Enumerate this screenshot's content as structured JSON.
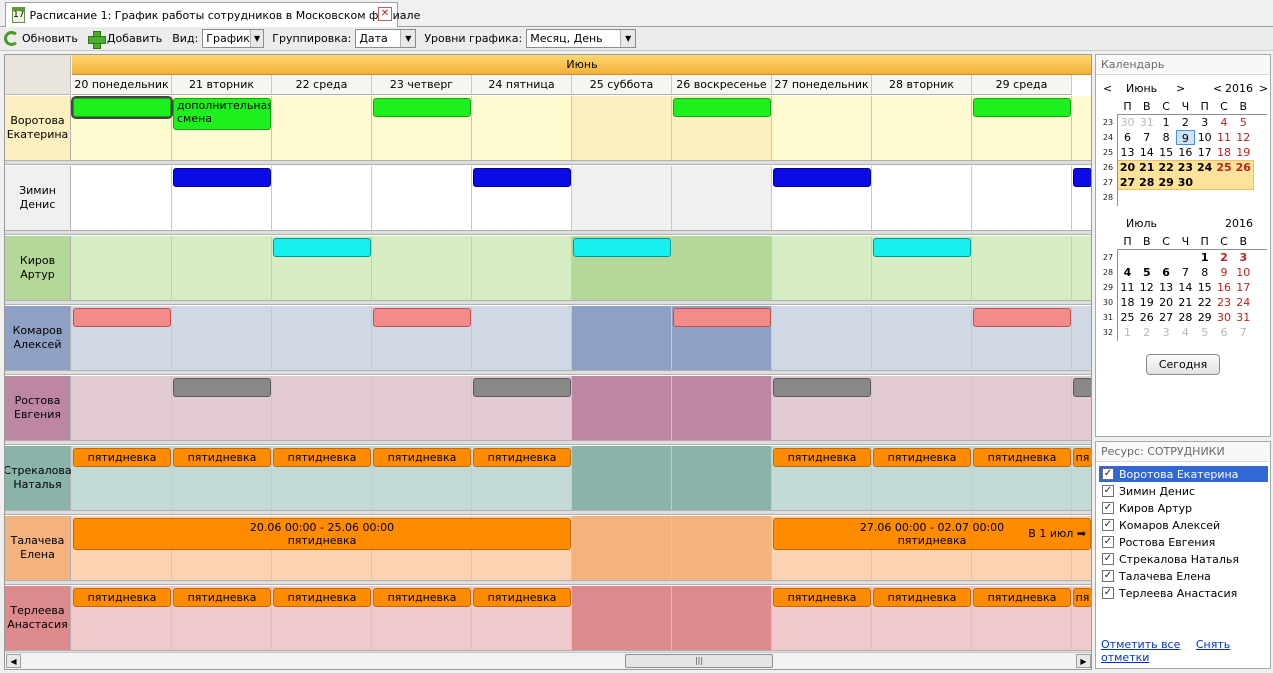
{
  "tab": {
    "icon": "calendar-icon",
    "icon_text": "17",
    "title": "Расписание 1: График работы сотрудников в Московском филиале",
    "close": "✕"
  },
  "toolbar": {
    "refresh": "Обновить",
    "add": "Добавить",
    "view_label": "Вид:",
    "view_value": "График",
    "group_label": "Группировка:",
    "group_value": "Дата",
    "levels_label": "Уровни графика:",
    "levels_value": "Месяц, День"
  },
  "schedule": {
    "month": "Июнь",
    "days": [
      "20 понедельник",
      "21 вторник",
      "22 среда",
      "23 четверг",
      "24 пятница",
      "25 суббота",
      "26 воскресенье",
      "27 понедельник",
      "28 вторник",
      "29 среда"
    ],
    "rows": [
      {
        "name": "Воротова Екатерина",
        "color": "#fffbd0",
        "weekend": "#fdf0c0",
        "events": [
          {
            "day": 0,
            "span": 1,
            "style": "green",
            "text": "",
            "selected": true
          },
          {
            "day": 1,
            "span": 1,
            "style": "green",
            "text": "дополнительная смена"
          },
          {
            "day": 3,
            "span": 1,
            "style": "green",
            "text": ""
          },
          {
            "day": 6,
            "span": 1,
            "style": "green",
            "text": ""
          },
          {
            "day": 9,
            "span": 1,
            "style": "green",
            "text": ""
          }
        ]
      },
      {
        "name": "Зимин Денис",
        "color": "#ffffff",
        "weekend": "#f0f0f0",
        "events": [
          {
            "day": 1,
            "span": 1,
            "style": "blue",
            "text": ""
          },
          {
            "day": 4,
            "span": 1,
            "style": "blue",
            "text": ""
          },
          {
            "day": 7,
            "span": 1,
            "style": "blue",
            "text": ""
          },
          {
            "day": 10,
            "span": 1,
            "style": "blue",
            "text": ""
          }
        ]
      },
      {
        "name": "Киров Артур",
        "color": "#d6ecc3",
        "weekend": "#b4d89a",
        "events": [
          {
            "day": 2,
            "span": 1,
            "style": "cyan",
            "text": ""
          },
          {
            "day": 5,
            "span": 1,
            "style": "cyan",
            "text": ""
          },
          {
            "day": 8,
            "span": 1,
            "style": "cyan",
            "text": ""
          }
        ]
      },
      {
        "name": "Комаров Алексей",
        "color": "#d0d8e6",
        "weekend": "#8ea0c3",
        "events": [
          {
            "day": 0,
            "span": 1,
            "style": "pink",
            "text": ""
          },
          {
            "day": 3,
            "span": 1,
            "style": "pink",
            "text": ""
          },
          {
            "day": 6,
            "span": 1,
            "style": "pink",
            "text": ""
          },
          {
            "day": 9,
            "span": 1,
            "style": "pink",
            "text": ""
          }
        ]
      },
      {
        "name": "Ростова Евгения",
        "color": "#e3cbd6",
        "weekend": "#bd87a3",
        "events": [
          {
            "day": 1,
            "span": 1,
            "style": "gray",
            "text": ""
          },
          {
            "day": 4,
            "span": 1,
            "style": "gray",
            "text": ""
          },
          {
            "day": 7,
            "span": 1,
            "style": "gray",
            "text": ""
          },
          {
            "day": 10,
            "span": 1,
            "style": "gray",
            "text": ""
          }
        ]
      },
      {
        "name": "Стрекалова Наталья",
        "color": "#c3dad6",
        "weekend": "#8ab4aa",
        "events": [
          {
            "day": 0,
            "span": 1,
            "style": "orange",
            "text": "пятидневка"
          },
          {
            "day": 1,
            "span": 1,
            "style": "orange",
            "text": "пятидневка"
          },
          {
            "day": 2,
            "span": 1,
            "style": "orange",
            "text": "пятидневка"
          },
          {
            "day": 3,
            "span": 1,
            "style": "orange",
            "text": "пятидневка"
          },
          {
            "day": 4,
            "span": 1,
            "style": "orange",
            "text": "пятидневка"
          },
          {
            "day": 7,
            "span": 1,
            "style": "orange",
            "text": "пятидневка"
          },
          {
            "day": 8,
            "span": 1,
            "style": "orange",
            "text": "пятидневка"
          },
          {
            "day": 9,
            "span": 1,
            "style": "orange",
            "text": "пятидневка"
          },
          {
            "day": 10,
            "span": 1,
            "style": "orange",
            "text": "пя"
          }
        ]
      },
      {
        "name": "Талачева Елена",
        "color": "#fbd3b3",
        "weekend": "#f4b27e",
        "events": [
          {
            "day": 0,
            "span": 5,
            "style": "orange",
            "wide": true,
            "line1": "20.06 00:00 - 25.06 00:00",
            "line2": "пятидневка"
          },
          {
            "day": 7,
            "span": 3.2,
            "style": "orange",
            "wide": true,
            "line1": "27.06 00:00 - 02.07 00:00",
            "line2": "пятидневка",
            "more": "В 1 июл ➡"
          }
        ]
      },
      {
        "name": "Терлеева Анастасия",
        "color": "#f0c9cc",
        "weekend": "#dc8a8c",
        "events": [
          {
            "day": 0,
            "span": 1,
            "style": "orange",
            "text": "пятидневка"
          },
          {
            "day": 1,
            "span": 1,
            "style": "orange",
            "text": "пятидневка"
          },
          {
            "day": 2,
            "span": 1,
            "style": "orange",
            "text": "пятидневка"
          },
          {
            "day": 3,
            "span": 1,
            "style": "orange",
            "text": "пятидневка"
          },
          {
            "day": 4,
            "span": 1,
            "style": "orange",
            "text": "пятидневка"
          },
          {
            "day": 7,
            "span": 1,
            "style": "orange",
            "text": "пятидневка"
          },
          {
            "day": 8,
            "span": 1,
            "style": "orange",
            "text": "пятидневка"
          },
          {
            "day": 9,
            "span": 1,
            "style": "orange",
            "text": "пятидневка"
          },
          {
            "day": 10,
            "span": 1,
            "style": "orange",
            "text": "пя"
          }
        ]
      }
    ],
    "scroll_thumb": "|||"
  },
  "calendar": {
    "title": "Календарь",
    "weekdays": [
      "П",
      "В",
      "С",
      "Ч",
      "П",
      "С",
      "В"
    ],
    "june": {
      "month": "Июнь",
      "year": "2016",
      "weeks": [
        "23",
        "24",
        "25",
        "26",
        "27",
        "28"
      ],
      "days": [
        [
          "30",
          "31",
          "1",
          "2",
          "3",
          "4",
          "5"
        ],
        [
          "6",
          "7",
          "8",
          "9",
          "10",
          "11",
          "12"
        ],
        [
          "13",
          "14",
          "15",
          "16",
          "17",
          "18",
          "19"
        ],
        [
          "20",
          "21",
          "22",
          "23",
          "24",
          "25",
          "26"
        ],
        [
          "27",
          "28",
          "29",
          "30",
          "",
          "",
          ""
        ],
        [
          "",
          "",
          "",
          "",
          "",
          "",
          ""
        ]
      ]
    },
    "july": {
      "month": "Июль",
      "year": "2016",
      "weeks": [
        "27",
        "28",
        "29",
        "30",
        "31",
        "32"
      ],
      "days": [
        [
          "",
          "",
          "",
          "",
          "1",
          "2",
          "3"
        ],
        [
          "4",
          "5",
          "6",
          "7",
          "8",
          "9",
          "10"
        ],
        [
          "11",
          "12",
          "13",
          "14",
          "15",
          "16",
          "17"
        ],
        [
          "18",
          "19",
          "20",
          "21",
          "22",
          "23",
          "24"
        ],
        [
          "25",
          "26",
          "27",
          "28",
          "29",
          "30",
          "31"
        ],
        [
          "1",
          "2",
          "3",
          "4",
          "5",
          "6",
          "7"
        ]
      ]
    },
    "today_button": "Сегодня"
  },
  "resources": {
    "title": "Ресурс: СОТРУДНИКИ",
    "items": [
      "Воротова Екатерина",
      "Зимин Денис",
      "Киров Артур",
      "Комаров Алексей",
      "Ростова Евгения",
      "Стрекалова Наталья",
      "Талачева Елена",
      "Терлеева Анастасия"
    ],
    "check_all": "Отметить все",
    "uncheck_all": "Снять отметки"
  }
}
